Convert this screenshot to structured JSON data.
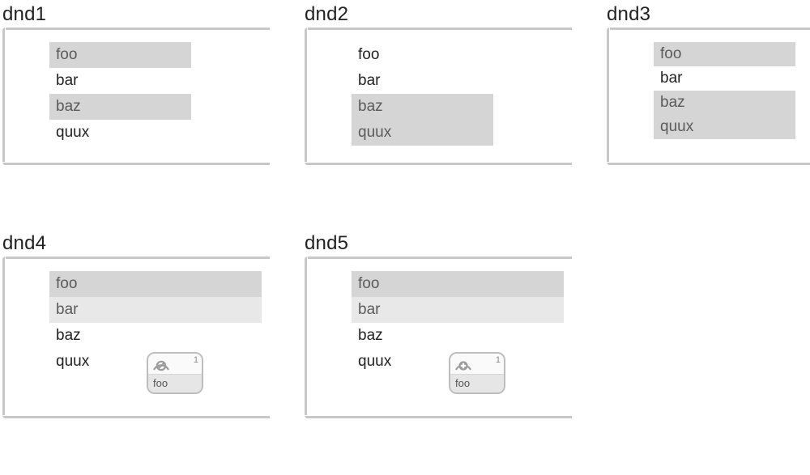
{
  "panels": {
    "d1": {
      "title": "dnd1",
      "items": [
        "foo",
        "bar",
        "baz",
        "quux"
      ]
    },
    "d2": {
      "title": "dnd2",
      "items": [
        "foo",
        "bar",
        "baz",
        "quux"
      ]
    },
    "d3": {
      "title": "dnd3",
      "items": [
        "foo",
        "bar",
        "baz",
        "quux"
      ]
    },
    "d4": {
      "title": "dnd4",
      "items": [
        "foo",
        "bar",
        "baz",
        "quux"
      ],
      "drag": {
        "count": "1",
        "label": "foo"
      }
    },
    "d5": {
      "title": "dnd5",
      "items": [
        "foo",
        "bar",
        "baz",
        "quux"
      ],
      "drag": {
        "count": "1",
        "label": "foo"
      }
    }
  }
}
